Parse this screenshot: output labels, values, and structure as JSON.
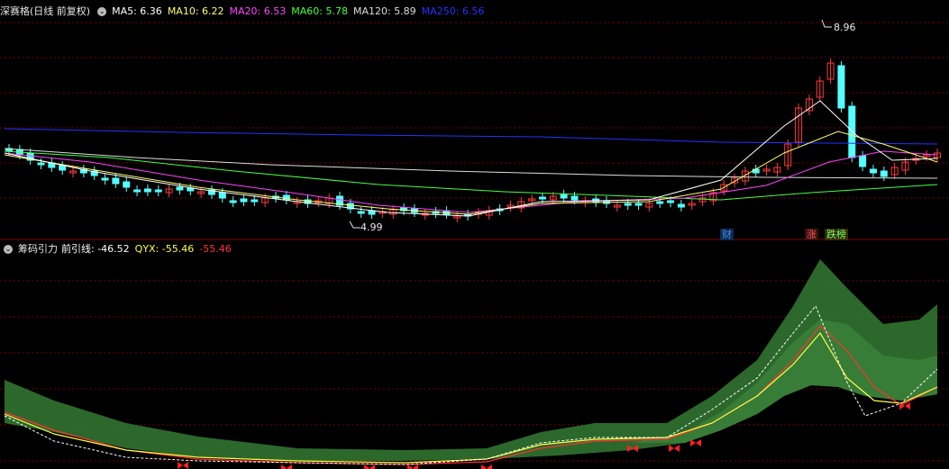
{
  "top_panel": {
    "title": "深赛格(日线 前复权)",
    "indicators": [
      {
        "label": "MA5: 6.36",
        "color": "#ffffff"
      },
      {
        "label": "MA10: 6.22",
        "color": "#ffff66"
      },
      {
        "label": "MA20: 6.53",
        "color": "#ff44ff"
      },
      {
        "label": "MA60: 5.78",
        "color": "#44ff44"
      },
      {
        "label": "MA120: 5.89",
        "color": "#dddddd"
      },
      {
        "label": "MA250: 6.56",
        "color": "#2233ff"
      }
    ],
    "high_label": "8.96",
    "low_label": "4.99",
    "event_tags": [
      {
        "text": "财",
        "color": "#4a8fe0",
        "bg": "#0b2a55"
      },
      {
        "text": "涨",
        "color": "#ff5555",
        "bg": "#3a0f0f"
      },
      {
        "text": "跌榜",
        "color": "#66ff66",
        "bg": "#3a2a0a"
      }
    ]
  },
  "bottom_panel": {
    "title": "筹码引力",
    "indicators": [
      {
        "label": "前引线: -46.52",
        "color": "#ffffff"
      },
      {
        "label": "QYX: -55.46",
        "color": "#ffff44"
      },
      {
        "label": "-55.46",
        "color": "#ff3333"
      }
    ]
  },
  "colors": {
    "up": "#ff3b3b",
    "down": "#54ffff",
    "grid": "#7a0000",
    "band": "#2e6e2e",
    "band_light": "#3f8a3f"
  }
}
